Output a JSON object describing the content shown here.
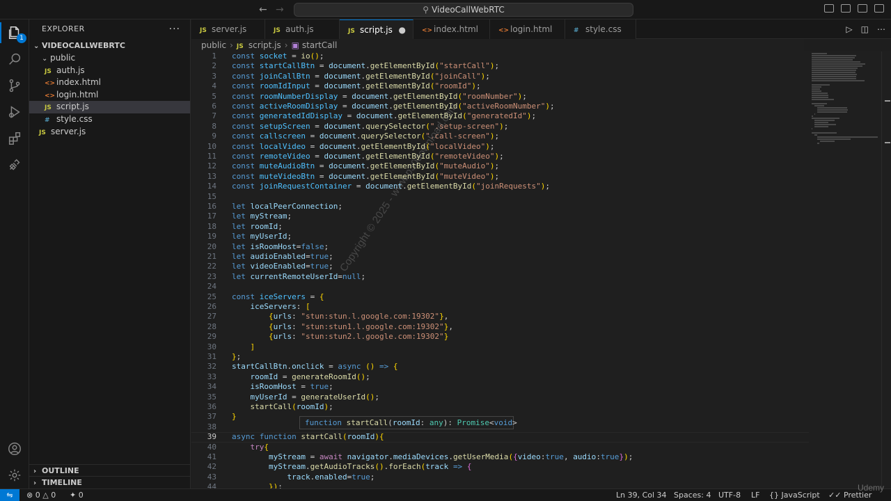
{
  "window": {
    "title": "VideoCallWebRTC",
    "search_icon": "search-icon"
  },
  "activity_bar": {
    "items": [
      {
        "name": "explorer-icon",
        "badge": "1"
      },
      {
        "name": "search-icon"
      },
      {
        "name": "source-control-icon"
      },
      {
        "name": "run-debug-icon"
      },
      {
        "name": "extensions-icon"
      },
      {
        "name": "remote-icon"
      }
    ],
    "bottom": [
      {
        "name": "account-icon"
      },
      {
        "name": "settings-gear-icon"
      }
    ]
  },
  "sidebar": {
    "title": "EXPLORER",
    "more": "···",
    "root": "VIDEOCALLWEBRTC",
    "tree": [
      {
        "label": "public",
        "type": "folder",
        "depth": 1
      },
      {
        "label": "auth.js",
        "type": "js",
        "depth": 2
      },
      {
        "label": "index.html",
        "type": "html",
        "depth": 2
      },
      {
        "label": "login.html",
        "type": "html",
        "depth": 2
      },
      {
        "label": "script.js",
        "type": "js",
        "depth": 2,
        "selected": true
      },
      {
        "label": "style.css",
        "type": "css",
        "depth": 2
      },
      {
        "label": "server.js",
        "type": "js",
        "depth": 1
      }
    ],
    "outline": "OUTLINE",
    "timeline": "TIMELINE"
  },
  "tabs": [
    {
      "label": "server.js",
      "icon": "JS"
    },
    {
      "label": "auth.js",
      "icon": "JS"
    },
    {
      "label": "script.js",
      "icon": "JS",
      "active": true,
      "modified": "●"
    },
    {
      "label": "index.html",
      "icon": "<>"
    },
    {
      "label": "login.html",
      "icon": "<>"
    },
    {
      "label": "style.css",
      "icon": "#"
    }
  ],
  "breadcrumb": [
    "public",
    "script.js",
    "startCall"
  ],
  "code_lines": [
    "const socket = io();",
    "const startCallBtn = document.getElementById(\"startCall\");",
    "const joinCallBtn = document.getElementById(\"joinCall\");",
    "const roomIdInput = document.getElementById(\"roomId\");",
    "const roomNumberDisplay = document.getElementById(\"roomNumber\");",
    "const activeRoomDisplay = document.getElementById(\"activeRoomNumber\");",
    "const generatedIdDisplay = document.getElementById(\"generatedId\");",
    "const setupScreen = document.querySelector(\".setup-screen\");",
    "const callscreen = document.querySelector(\".call-screen\");",
    "const localVideo = document.getElementById(\"localVideo\");",
    "const remoteVideo = document.getElementById(\"remoteVideo\");",
    "const muteAudioBtn = document.getElementById(\"muteAudio\");",
    "const muteVideoBtn = document.getElementById(\"muteVideo\");",
    "const joinRequestContainer = document.getElementById(\"joinRequests\");",
    "",
    "let localPeerConnection;",
    "let myStream;",
    "let roomId;",
    "let myUserId;",
    "let isRoomHost=false;",
    "let audioEnabled=true;",
    "let videoEnabled=true;",
    "let currentRemoteUserId=null;",
    "",
    "const iceServers = {",
    "    iceServers: [",
    "        {urls: \"stun:stun.l.google.com:19302\"},",
    "        {urls: \"stun:stun1.l.google.com:19302\"},",
    "        {urls: \"stun:stun2.l.google.com:19302\"}",
    "    ]",
    "};",
    "startCallBtn.onclick = async () => {",
    "    roomId = generateRoomId();",
    "    isRoomHost = true;",
    "    myUserId = generateUserId();",
    "    startCall(roomId);",
    "}",
    "",
    "async function startCall(roomId){",
    "    try{",
    "        myStream = await navigator.mediaDevices.getUserMedia({video:true, audio:true});",
    "        myStream.getAudioTracks().forEach(track => {",
    "            track.enabled=true;",
    "        });"
  ],
  "current_line": 39,
  "hover_text": "function startCall(roomId: any): Promise<void>",
  "watermark": "Copyright © 2025 - www.p30download.com",
  "status": {
    "errors": "0",
    "warnings": "0",
    "ports": "0",
    "position": "Ln 39, Col 34",
    "spaces": "Spaces: 4",
    "encoding": "UTF-8",
    "eol": "LF",
    "language": "JavaScript",
    "formatter": "Prettier"
  },
  "udemy": "Udemy"
}
